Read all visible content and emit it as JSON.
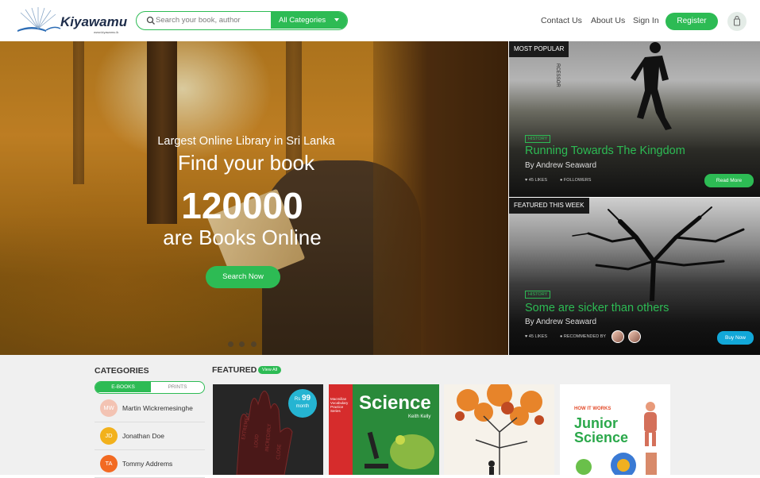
{
  "header": {
    "logo_text": "Kiyawamu",
    "logo_sub": "www.kiyawamu.lk",
    "search_placeholder": "Search your book, author",
    "category_label": "All Categories",
    "nav": [
      "Contact Us",
      "About Us",
      "Sign In"
    ],
    "register_label": "Register"
  },
  "hero": {
    "subtitle": "Largest Online Library in Sri Lanka",
    "title": "Find your book",
    "count": "120000",
    "tail": "are Books Online",
    "button": "Search Now",
    "slides": 3
  },
  "cards": [
    {
      "tag": "MOST POPULAR",
      "genre": "HISTORY",
      "title": "Running Towards The Kingdom",
      "author": "By Andrew Seaward",
      "meta1": "45 LIKES",
      "meta2": "FOLLOWERS",
      "button": "Read More",
      "spine_text": "RCESSOR"
    },
    {
      "tag": "FEATURED THIS WEEK",
      "genre": "HISTORY",
      "title": "Some are sicker than others",
      "author": "By Andrew Seaward",
      "meta1": "45 LIKES",
      "meta2": "RECOMMENDED BY",
      "button": "Buy Now"
    }
  ],
  "categories": {
    "title": "CATEGORIES",
    "tabs": [
      "E-BOOKS",
      "PRINTS"
    ],
    "active_tab": "E-BOOKS",
    "authors": [
      {
        "initials": "MW",
        "name": "Martin Wickremesinghe",
        "color": "#f3c3b3"
      },
      {
        "initials": "JD",
        "name": "Jonathan Doe",
        "color": "#f2b11c"
      },
      {
        "initials": "TA",
        "name": "Tommy Addrems",
        "color": "#f26a22"
      }
    ]
  },
  "featured": {
    "title": "FEATURED",
    "view_all": "View All",
    "price_currency": "Rs",
    "price_value": "99",
    "price_unit": "month",
    "book2_title": "Science",
    "book2_author": "Keith Kelly",
    "book2_series": "Macmillan Vocabulary Practice Series",
    "book4_top": "HOW IT WORKS",
    "book4_title": "Junior Science"
  }
}
